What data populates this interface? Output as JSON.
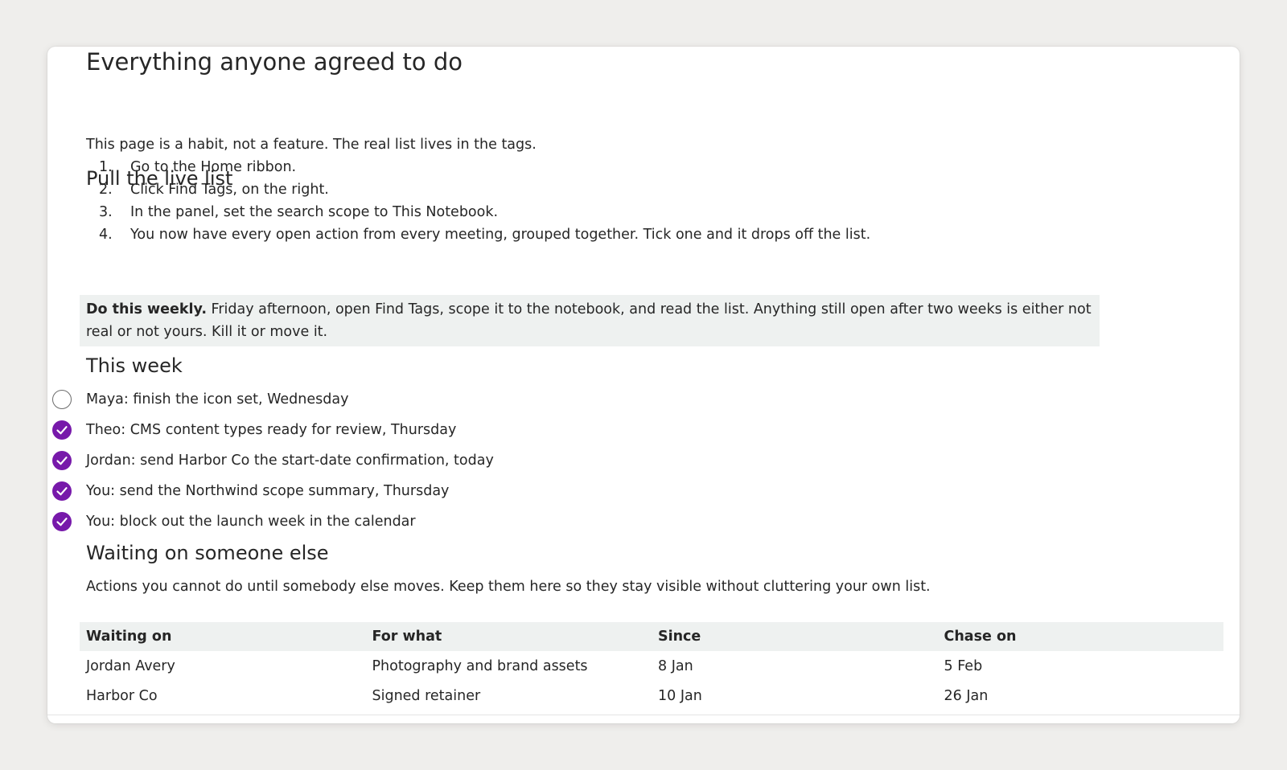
{
  "page": {
    "title": "Everything anyone agreed to do",
    "intro": "This page is a habit, not a feature. The real list lives in the tags."
  },
  "pull": {
    "heading": "Pull the live list",
    "steps": [
      {
        "num": "1.",
        "text": "Go to the Home ribbon."
      },
      {
        "num": "2.",
        "text": "Click Find Tags, on the right."
      },
      {
        "num": "3.",
        "text": "In the panel, set the search scope to This Notebook."
      },
      {
        "num": "4.",
        "text": "You now have every open action from every meeting, grouped together. Tick one and it drops off the list."
      }
    ],
    "callout_bold": "Do this weekly.",
    "callout_text": " Friday afternoon, open Find Tags, scope it to the notebook, and read the list. Anything still open after two weeks is either not real or not yours. Kill it or move it."
  },
  "week": {
    "heading": "This week",
    "items": [
      {
        "text": "Maya: finish the icon set, Wednesday",
        "done": false
      },
      {
        "text": "Theo: CMS content types ready for review, Thursday",
        "done": true
      },
      {
        "text": "Jordan: send Harbor Co the start-date confirmation, today",
        "done": true
      },
      {
        "text": "You: send the Northwind scope summary, Thursday",
        "done": true
      },
      {
        "text": "You: block out the launch week in the calendar",
        "done": true
      }
    ]
  },
  "waiting": {
    "heading": "Waiting on someone else",
    "intro": "Actions you cannot do until somebody else moves. Keep them here so they stay visible without cluttering your own list.",
    "columns": [
      "Waiting on",
      "For what",
      "Since",
      "Chase on"
    ],
    "rows": [
      [
        "Jordan Avery",
        "Photography and brand assets",
        "8 Jan",
        "5 Feb"
      ],
      [
        "Harbor Co",
        "Signed retainer",
        "10 Jan",
        "26 Jan"
      ]
    ]
  },
  "colors": {
    "accent": "#7719aa",
    "callout_bg": "#eef1f0"
  },
  "icons": {
    "done": "checkmark-circle-icon",
    "open": "empty-circle-icon"
  }
}
